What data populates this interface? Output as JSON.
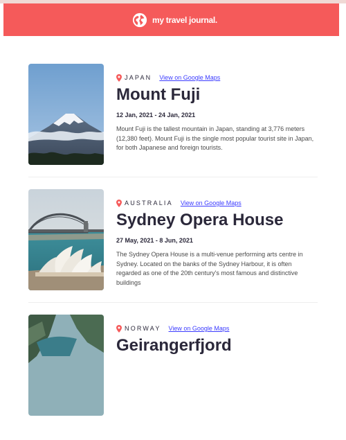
{
  "header": {
    "brand": "my travel journal.",
    "logo_icon": "globe-icon",
    "background": "#f55a5a"
  },
  "entries": [
    {
      "country": "JAPAN",
      "maps_link": "View on Google Maps",
      "title": "Mount Fuji",
      "dates": "12 Jan, 2021 - 24 Jan, 2021",
      "description": "Mount Fuji is the tallest mountain in Japan, standing at 3,776 meters (12,380 feet). Mount Fuji is the single most popular tourist site in Japan, for both Japanese and foreign tourists.",
      "image": "mount-fuji-photo"
    },
    {
      "country": "AUSTRALIA",
      "maps_link": "View on Google Maps",
      "title": "Sydney Opera House",
      "dates": "27 May, 2021 - 8 Jun, 2021",
      "description": "The Sydney Opera House is a multi-venue performing arts centre in Sydney. Located on the banks of the Sydney Harbour, it is often regarded as one of the 20th century's most famous and distinctive buildings",
      "image": "sydney-opera-house-photo"
    },
    {
      "country": "NORWAY",
      "maps_link": "View on Google Maps",
      "title": "Geirangerfjord",
      "dates": "",
      "description": "",
      "image": "geirangerfjord-photo"
    }
  ],
  "colors": {
    "accent": "#f55a5a",
    "link": "#3b3bff",
    "text": "#2b283a"
  }
}
